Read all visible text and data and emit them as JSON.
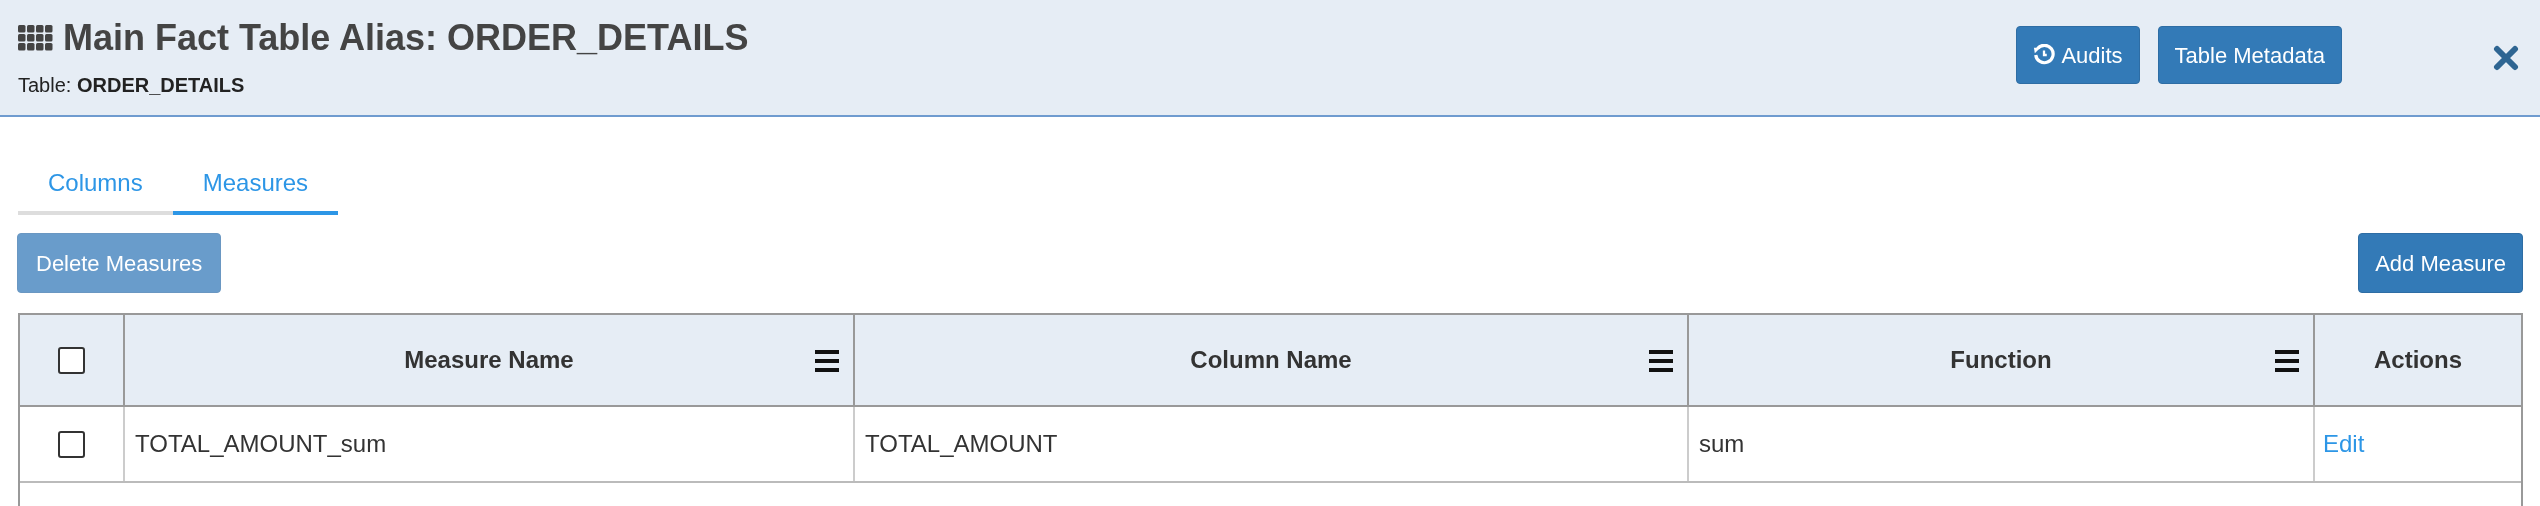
{
  "header": {
    "title": "Main Fact Table Alias: ORDER_DETAILS",
    "subtitle_label": "Table: ",
    "subtitle_value": "ORDER_DETAILS",
    "buttons": [
      {
        "label": "Audits",
        "kind": "history"
      },
      {
        "label": "Table Metadata",
        "kind": "plain"
      }
    ]
  },
  "tabs": [
    {
      "label": "Columns",
      "selected": false
    },
    {
      "label": "Measures",
      "selected": true
    }
  ],
  "toolbar": {
    "delete_button": {
      "label": "Delete Measures",
      "disabled": true
    },
    "add_button": {
      "label": "Add Measure"
    }
  },
  "table": {
    "select_all_checked": false,
    "columns": [
      {
        "label": "Measure Name",
        "menu": true
      },
      {
        "label": "Column Name",
        "menu": true
      },
      {
        "label": "Function",
        "menu": true
      },
      {
        "label": "Actions",
        "menu": false
      }
    ],
    "rows": [
      {
        "checked": false,
        "measure_name": "TOTAL_AMOUNT_sum",
        "column_name": "TOTAL_AMOUNT",
        "function": "sum",
        "action": "Edit"
      }
    ]
  }
}
